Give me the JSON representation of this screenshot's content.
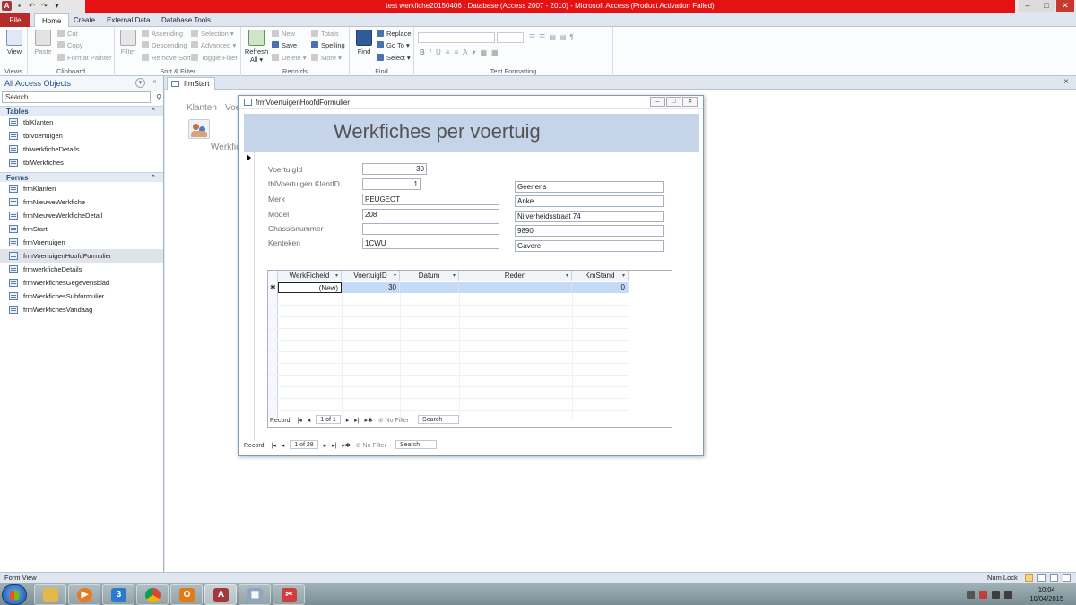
{
  "window": {
    "title": "test werkfiche20150406 : Database (Access 2007 - 2010) - Microsoft Access (Product Activation Failed)",
    "controls": {
      "minimize": "–",
      "maximize": "□",
      "close": "✕"
    }
  },
  "ribbon": {
    "tabs": [
      "File",
      "Home",
      "Create",
      "External Data",
      "Database Tools"
    ],
    "active_tab": "Home",
    "groups": {
      "views": {
        "label": "Views",
        "view": "View"
      },
      "clipboard": {
        "label": "Clipboard",
        "paste": "Paste",
        "cut": "Cut",
        "copy": "Copy",
        "format_painter": "Format Painter"
      },
      "sort_filter": {
        "label": "Sort & Filter",
        "filter": "Filter",
        "ascending": "Ascending",
        "descending": "Descending",
        "remove_sort": "Remove Sort",
        "selection": "Selection ▾",
        "advanced": "Advanced ▾",
        "toggle_filter": "Toggle Filter"
      },
      "records": {
        "label": "Records",
        "refresh_all": "Refresh All ▾",
        "new": "New",
        "save": "Save",
        "delete": "Delete ▾",
        "totals": "Totals",
        "spelling": "Spelling",
        "more": "More ▾"
      },
      "find": {
        "label": "Find",
        "find": "Find",
        "replace": "Replace",
        "go_to": "Go To ▾",
        "select": "Select ▾"
      },
      "text_formatting": {
        "label": "Text Formatting"
      }
    }
  },
  "nav": {
    "header": "All Access Objects",
    "search_placeholder": "Search...",
    "sections": [
      {
        "title": "Tables",
        "items": [
          "tblKlanten",
          "tblVoertuigen",
          "tblwerkficheDetails",
          "tblWerkfiches"
        ]
      },
      {
        "title": "Forms",
        "items": [
          "frmKlanten",
          "frmNieuweWerkfiche",
          "frmNieuweWerkficheDetail",
          "frmStart",
          "frmVoertuigen",
          "frmVoertuigenHoofdFormulier",
          "frmwerkficheDetails",
          "frmWerkfichesGegevensblad",
          "frmWerkfichesSubformulier",
          "frmWerkfichesVandaag"
        ]
      }
    ],
    "selected_item": "frmVoertuigenHoofdFormulier"
  },
  "doc_tab": {
    "label": "frmStart",
    "close": "×"
  },
  "background_form": {
    "tab1": "Klanten",
    "tab2": "Voe",
    "caption": "Werkfic"
  },
  "popup": {
    "title": "frmVoertuigenHoofdFormulier",
    "header": "Werkfiches per voertuig",
    "fields": {
      "voertuigid": {
        "label": "VoertuigId",
        "value": "30"
      },
      "klantid": {
        "label": "tblVoertuigen.KlantID",
        "value": "1"
      },
      "merk": {
        "label": "Merk",
        "value": "PEUGEOT"
      },
      "model": {
        "label": "Model",
        "value": "208"
      },
      "chassis": {
        "label": "Chassisnummer",
        "value": ""
      },
      "kenteken": {
        "label": "Kenteken",
        "value": "1CWU"
      },
      "klant_naam": "Geenens",
      "klant_voornaam": "Anke",
      "klant_adres": "Nijverheidsstraat 74",
      "klant_postcode": "9890",
      "klant_gemeente": "Gavere"
    },
    "subform": {
      "columns": [
        "WerkFicheId",
        "VoertuigID",
        "Datum",
        "Reden",
        "KmStand"
      ],
      "new_row": {
        "werkficheid": "(New)",
        "voertuigid": "30",
        "datum": "",
        "reden": "",
        "kmstand": "0"
      },
      "nav": {
        "record_label": "Record:",
        "position": "1 of 1",
        "no_filter": "No Filter",
        "search": "Search"
      }
    },
    "nav": {
      "record_label": "Record:",
      "position": "1 of 28",
      "no_filter": "No Filter",
      "search": "Search"
    }
  },
  "statusbar": {
    "left": "Form View",
    "numlock": "Num Lock"
  },
  "taskbar": {
    "time": "10:04",
    "date": "10/04/2015",
    "calendar_day": "3",
    "acc": "A"
  },
  "colors": {
    "title_red": "#e41212",
    "file_tab": "#b72b2b",
    "form_header": "#c5d4e8",
    "selection_blue": "#c5daf6"
  }
}
